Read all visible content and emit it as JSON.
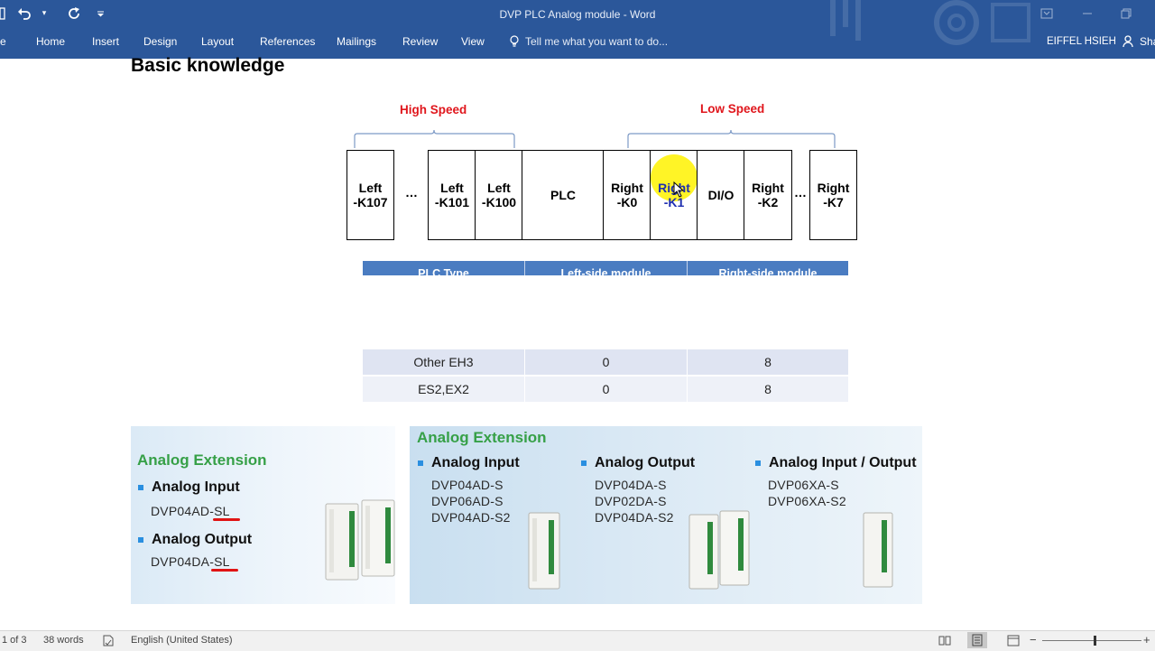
{
  "window": {
    "title": "DVP PLC Analog module - Word"
  },
  "quick_access": {
    "save_icon": "save-icon",
    "undo_icon": "undo-icon",
    "redo_icon": "redo-icon",
    "customize_icon": "chevron-down-icon"
  },
  "ribbon": {
    "file_partial": "e",
    "tabs": [
      "Home",
      "Insert",
      "Design",
      "Layout",
      "References",
      "Mailings",
      "Review",
      "View"
    ],
    "tell_me": "Tell me what you want to do...",
    "user": "EIFFEL HSIEH",
    "share": "Sha",
    "color": "#2b579a"
  },
  "document": {
    "heading": "Basic knowledge",
    "high_speed_label": "High Speed",
    "low_speed_label": "Low Speed",
    "slots": [
      {
        "line1": "Left",
        "line2": "-K107"
      },
      {
        "line1": "Left",
        "line2": "-K101"
      },
      {
        "line1": "Left",
        "line2": "-K100"
      },
      {
        "line1": "PLC",
        "line2": ""
      },
      {
        "line1": "Right",
        "line2": "-K0"
      },
      {
        "line1": "Right",
        "line2": "-K1"
      },
      {
        "line1": "DI/O",
        "line2": ""
      },
      {
        "line1": "Right",
        "line2": "-K2"
      },
      {
        "line1": "Right",
        "line2": "-K7"
      }
    ],
    "ellipsis": "…",
    "table": {
      "headers": [
        "PLC Type",
        "Left-side module",
        "Right-side module"
      ],
      "rows": [
        [
          "Other EH3",
          "0",
          "8"
        ],
        [
          "ES2,EX2",
          "0",
          "8"
        ]
      ]
    },
    "panel_left": {
      "title": "Analog Extension",
      "input_heading": "Analog Input",
      "input_model_prefix": "DVP04AD-",
      "input_model_suffix": "SL",
      "output_heading": "Analog Output",
      "output_model_prefix": "DVP04DA-",
      "output_model_suffix": "SL"
    },
    "panel_right": {
      "title": "Analog Extension",
      "columns": [
        {
          "heading": "Analog Input",
          "models": [
            "DVP04AD-S",
            "DVP06AD-S",
            "DVP04AD-S2"
          ]
        },
        {
          "heading": "Analog Output",
          "models": [
            "DVP04DA-S",
            "DVP02DA-S",
            "DVP04DA-S2"
          ]
        },
        {
          "heading": "Analog Input / Output",
          "models": [
            "DVP06XA-S",
            "DVP06XA-S2"
          ]
        }
      ]
    }
  },
  "status_bar": {
    "page": "1 of 3",
    "words": "38 words",
    "language": "English (United States)"
  },
  "colors": {
    "high_speed": "#e0161c",
    "low_speed": "#e0161c",
    "panel_title": "#36a047",
    "table_header": "#4a7cc1",
    "row_even": "#dfe4f2",
    "row_odd": "#eef1f8"
  }
}
